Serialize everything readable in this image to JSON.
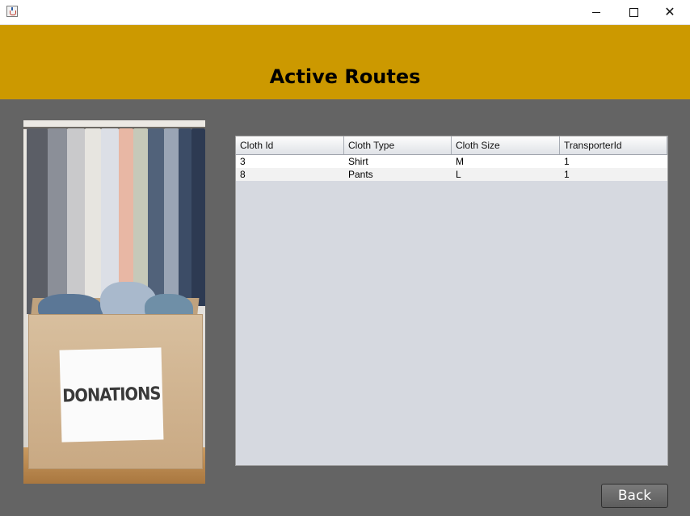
{
  "window": {
    "icon": "java-cup-icon",
    "controls": {
      "minimize": "minimize-icon",
      "maximize": "maximize-icon",
      "close": "close-icon"
    }
  },
  "header": {
    "title": "Active Routes",
    "background": "#cc9900"
  },
  "image": {
    "label": "DONATIONS"
  },
  "table": {
    "columns": [
      "Cloth Id",
      "Cloth Type",
      "Cloth Size",
      "TransporterId"
    ],
    "rows": [
      [
        "3",
        "Shirt",
        "M",
        "1"
      ],
      [
        "8",
        "Pants",
        "L",
        "1"
      ]
    ]
  },
  "actions": {
    "back_label": "Back"
  },
  "colors": {
    "content_background": "#646464",
    "table_background": "#d6d9e0"
  }
}
